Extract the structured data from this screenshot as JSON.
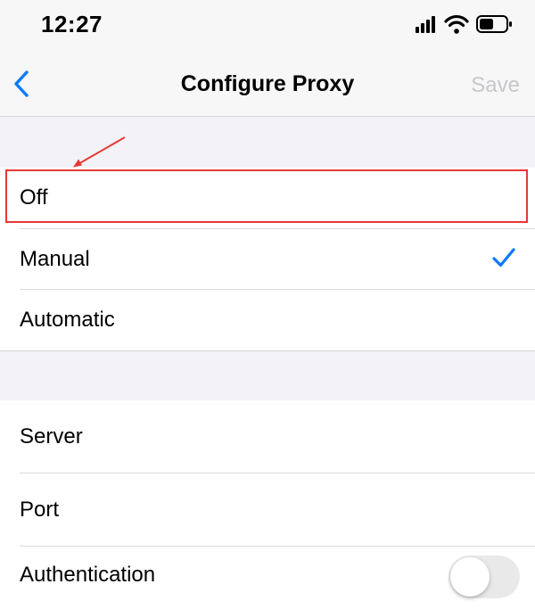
{
  "status_bar": {
    "time": "12:27"
  },
  "nav": {
    "title": "Configure Proxy",
    "save_label": "Save"
  },
  "proxy_modes": {
    "off_label": "Off",
    "manual_label": "Manual",
    "automatic_label": "Automatic",
    "selected": "Manual"
  },
  "settings": {
    "server_label": "Server",
    "port_label": "Port",
    "authentication_label": "Authentication",
    "authentication_enabled": false
  },
  "colors": {
    "accent": "#0a7aff",
    "highlight": "#e53935",
    "disabled": "#c7c7cc"
  }
}
